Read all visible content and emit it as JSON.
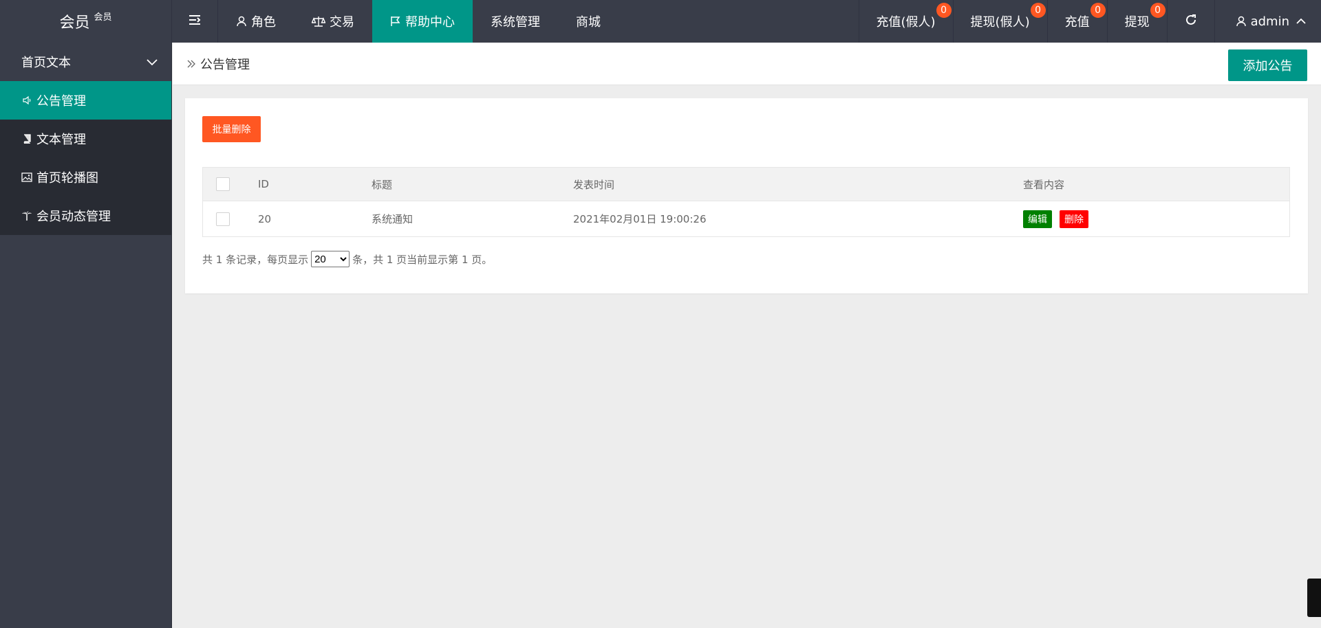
{
  "app": {
    "logo_main": "会员",
    "logo_sup": "会员"
  },
  "topnav": {
    "items": [
      {
        "label": "角色",
        "icon": "user-icon"
      },
      {
        "label": "交易",
        "icon": "scale-icon"
      },
      {
        "label": "帮助中心",
        "icon": "flag-icon",
        "active": true
      },
      {
        "label": "系统管理"
      },
      {
        "label": "商城"
      }
    ]
  },
  "rightnav": {
    "items": [
      {
        "label": "充值(假人)",
        "badge": "0"
      },
      {
        "label": "提现(假人)",
        "badge": "0"
      },
      {
        "label": "充值",
        "badge": "0"
      },
      {
        "label": "提现",
        "badge": "0"
      }
    ],
    "user": "admin"
  },
  "sidebar": {
    "group": "首页文本",
    "items": [
      {
        "label": "公告管理",
        "icon": "speaker-icon",
        "active": true
      },
      {
        "label": "文本管理",
        "icon": "book-icon"
      },
      {
        "label": "首页轮播图",
        "icon": "image-icon"
      },
      {
        "label": "会员动态管理",
        "icon": "palm-icon"
      }
    ]
  },
  "breadcrumb": {
    "current": "公告管理"
  },
  "actions": {
    "add": "添加公告",
    "batch_delete": "批量删除"
  },
  "table": {
    "headers": {
      "id": "ID",
      "title": "标题",
      "time": "发表时间",
      "content": "查看内容"
    },
    "rows": [
      {
        "id": "20",
        "title": "系统通知",
        "time": "2021年02月01日 19:00:26",
        "edit": "编辑",
        "delete": "删除"
      }
    ]
  },
  "pager": {
    "prefix": "共 1 条记录，每页显示",
    "page_size": "20",
    "suffix": "条，共 1 页当前显示第 1 页。"
  },
  "colors": {
    "header_bg": "#393d49",
    "accent": "#009688",
    "danger_orange": "#ff5722",
    "edit_green": "#008000",
    "delete_red": "#ff0000"
  }
}
